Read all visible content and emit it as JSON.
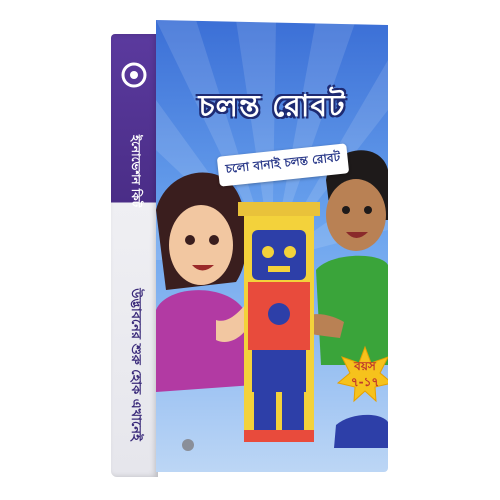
{
  "spine": {
    "brand": "ইনোভেশন কিট",
    "tagline": "উদ্ভাবনের শুরু হোক এখানেই"
  },
  "front": {
    "title": "চলন্ত রোবট",
    "subtitle": "চলো বানাই চলন্ত রোবট",
    "age_label": "বয়স",
    "age_range": "৭-১৭"
  },
  "colors": {
    "spine_purple": "#4a2d87",
    "sky_blue": "#4a86e0",
    "robot_yellow": "#f3d23b",
    "robot_blue": "#2d3fa8",
    "badge_yellow": "#f6c21c",
    "girl_dress": "#b23aa3",
    "boy_shirt": "#3aa43a"
  }
}
